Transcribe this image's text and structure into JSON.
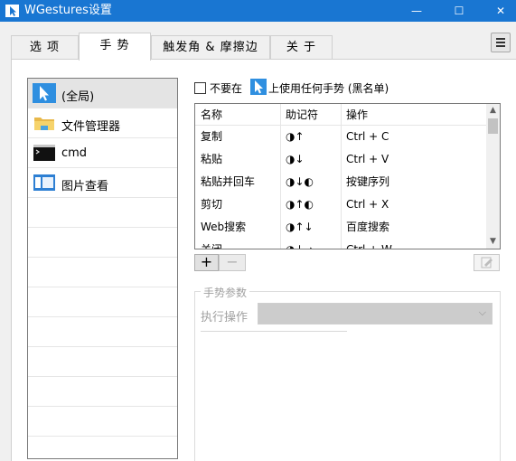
{
  "window": {
    "title": "WGestures设置"
  },
  "window_controls": {
    "minimize": "—",
    "maximize": "☐",
    "close": "✕"
  },
  "tabs": [
    {
      "label": "选 项"
    },
    {
      "label": "手 势"
    },
    {
      "label": "触发角 & 摩擦边"
    },
    {
      "label": "关 于"
    }
  ],
  "app_list": [
    {
      "label": "(全局)",
      "icon": "cursor-icon"
    },
    {
      "label": "文件管理器",
      "icon": "folder-icon"
    },
    {
      "label": "cmd",
      "icon": "console-icon"
    },
    {
      "label": "图片查看",
      "icon": "image-viewer-icon"
    }
  ],
  "blacklist": {
    "prefix": "不要在",
    "suffix": "上使用任何手势 (黑名单)"
  },
  "gesture_table": {
    "headers": [
      "名称",
      "助记符",
      "操作"
    ],
    "rows": [
      [
        "复制",
        "◑↑",
        "Ctrl + C"
      ],
      [
        "粘贴",
        "◑↓",
        "Ctrl + V"
      ],
      [
        "粘贴并回车",
        "◑↓◐",
        "按键序列"
      ],
      [
        "剪切",
        "◑↑◐",
        "Ctrl + X"
      ],
      [
        "Web搜索",
        "◑↑↓",
        "百度搜索"
      ],
      [
        "关闭",
        "◑↓→",
        "Ctrl + W"
      ]
    ]
  },
  "toolbar": {
    "add": "+",
    "remove": "−"
  },
  "gesture_params": {
    "legend": "手势参数",
    "exec_label": "执行操作",
    "chevron": "⌵"
  }
}
